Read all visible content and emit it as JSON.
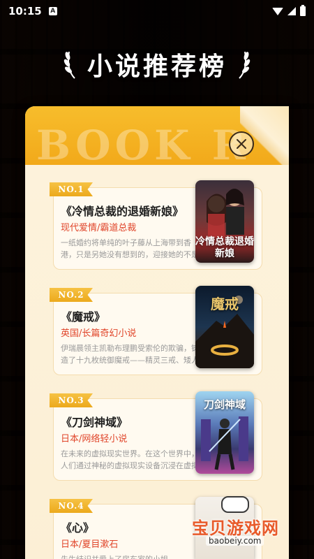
{
  "status_bar": {
    "time": "10:15",
    "notification_glyph": "A"
  },
  "header": {
    "title": "小说推荐榜",
    "decor_word": "BOOK R"
  },
  "colors": {
    "accent": "#f2a91a",
    "genre_red": "#e0452a",
    "panel_bg": "#fdf3dc"
  },
  "books": [
    {
      "rank": "NO.1",
      "title": "《冷情总裁的退婚新娘》",
      "genre": "现代爱情/霸道总裁",
      "desc": "一纸婚约将单纯的叶子藤从上海带到香港，只是另她没有想到的，迎接她的不是豪华的爱情...",
      "cover_text": "冷情总裁退婚新娘"
    },
    {
      "rank": "NO.2",
      "title": "《魔戒》",
      "genre": "英国/长篇奇幻小说",
      "desc": "伊瑞晨领主凯勒布理鹏受索伦的欺骗，铸造了十九枚统御魔戒——精灵三戒、矮人七戒和人类九戒...",
      "cover_text": "魔戒"
    },
    {
      "rank": "NO.3",
      "title": "《刀剑神域》",
      "genre": "日本/网络轻小说",
      "desc": "在未来的虚拟现实世界。在这个世界中，人们通过神秘的虚拟现实设备沉浸在虚拟游戏世界中...",
      "cover_text": "刀剑神域"
    },
    {
      "rank": "NO.4",
      "title": "《心》",
      "genre": "日本/夏目漱石",
      "desc": "先生结识并爱上了房东家的小姐，",
      "cover_text": ""
    }
  ],
  "watermark": {
    "main": "宝贝游戏网",
    "sub": "baobeiy.com"
  }
}
